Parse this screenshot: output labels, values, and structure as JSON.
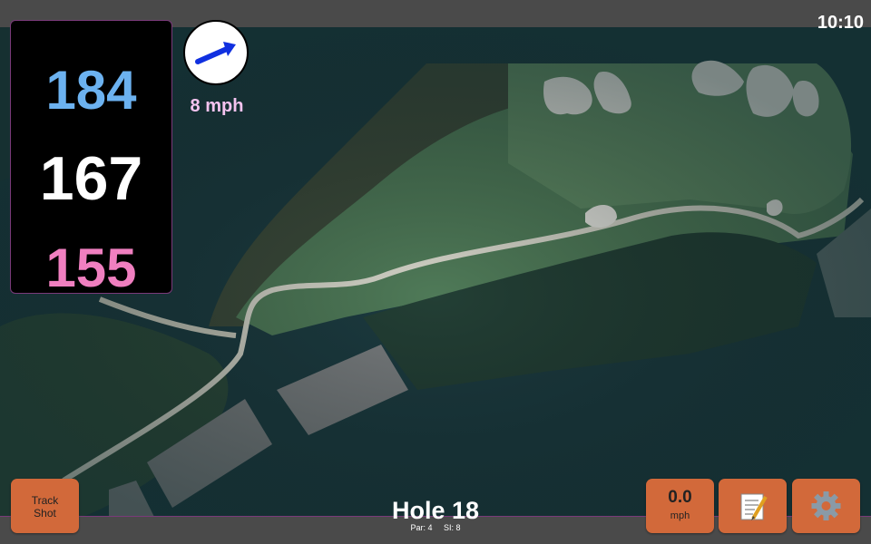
{
  "status": {
    "time": "10:10"
  },
  "distances": {
    "back": "184",
    "middle": "167",
    "front": "155"
  },
  "wind": {
    "label": "8 mph",
    "icon": "wind-direction-arrow-icon"
  },
  "buttons": {
    "track_shot_line1": "Track",
    "track_shot_line2": "Shot",
    "speed_value": "0.0",
    "speed_unit": "mph",
    "notes_icon": "notepad-icon",
    "settings_icon": "gear-icon"
  },
  "hole": {
    "title": "Hole 18",
    "par": "Par: 4",
    "si": "SI: 8"
  },
  "colors": {
    "back": "#6cb2f0",
    "middle": "#ffffff",
    "front": "#f07fc0",
    "button": "#d2693a",
    "wind_text": "#f4c3ef"
  }
}
